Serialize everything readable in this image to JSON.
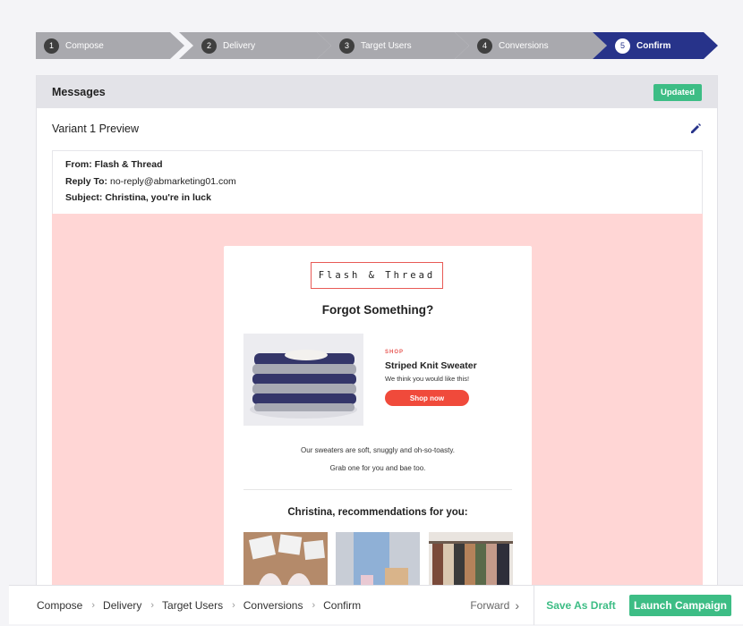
{
  "stepper": {
    "steps": [
      {
        "num": "1",
        "label": "Compose"
      },
      {
        "num": "2",
        "label": "Delivery"
      },
      {
        "num": "3",
        "label": "Target Users"
      },
      {
        "num": "4",
        "label": "Conversions"
      },
      {
        "num": "5",
        "label": "Confirm"
      }
    ],
    "active_index": 4,
    "colors": {
      "inactive": "#a9a9ae",
      "active": "#27338a"
    }
  },
  "panel": {
    "title": "Messages",
    "badge": "Updated",
    "variant_title": "Variant 1 Preview",
    "edit_icon": "pencil-icon"
  },
  "email_headers": {
    "from_label": "From:",
    "from_value": "Flash & Thread",
    "reply_label": "Reply To:",
    "reply_value": "no-reply@abmarketing01.com",
    "subject_label": "Subject:",
    "subject_value": "Christina, you're in luck"
  },
  "email": {
    "brand": "Flash & Thread",
    "headline": "Forgot Something?",
    "shop_tag": "SHOP",
    "product_name": "Striped Knit Sweater",
    "product_sub": "We think you would like this!",
    "shop_button": "Shop now",
    "body_line1": "Our sweaters are soft, snuggly and oh-so-toasty.",
    "body_line2": "Grab one for you and bae too.",
    "reco_title": "Christina, recommendations for you:"
  },
  "bottom_nav": {
    "crumbs": [
      "Compose",
      "Delivery",
      "Target Users",
      "Conversions",
      "Confirm"
    ],
    "forward": "Forward",
    "save_draft": "Save As Draft",
    "launch": "Launch Campaign"
  },
  "colors": {
    "accent_green": "#3dbd85",
    "brand_red": "#e85a56",
    "email_bg": "#ffd6d5",
    "active_step": "#27338a"
  }
}
